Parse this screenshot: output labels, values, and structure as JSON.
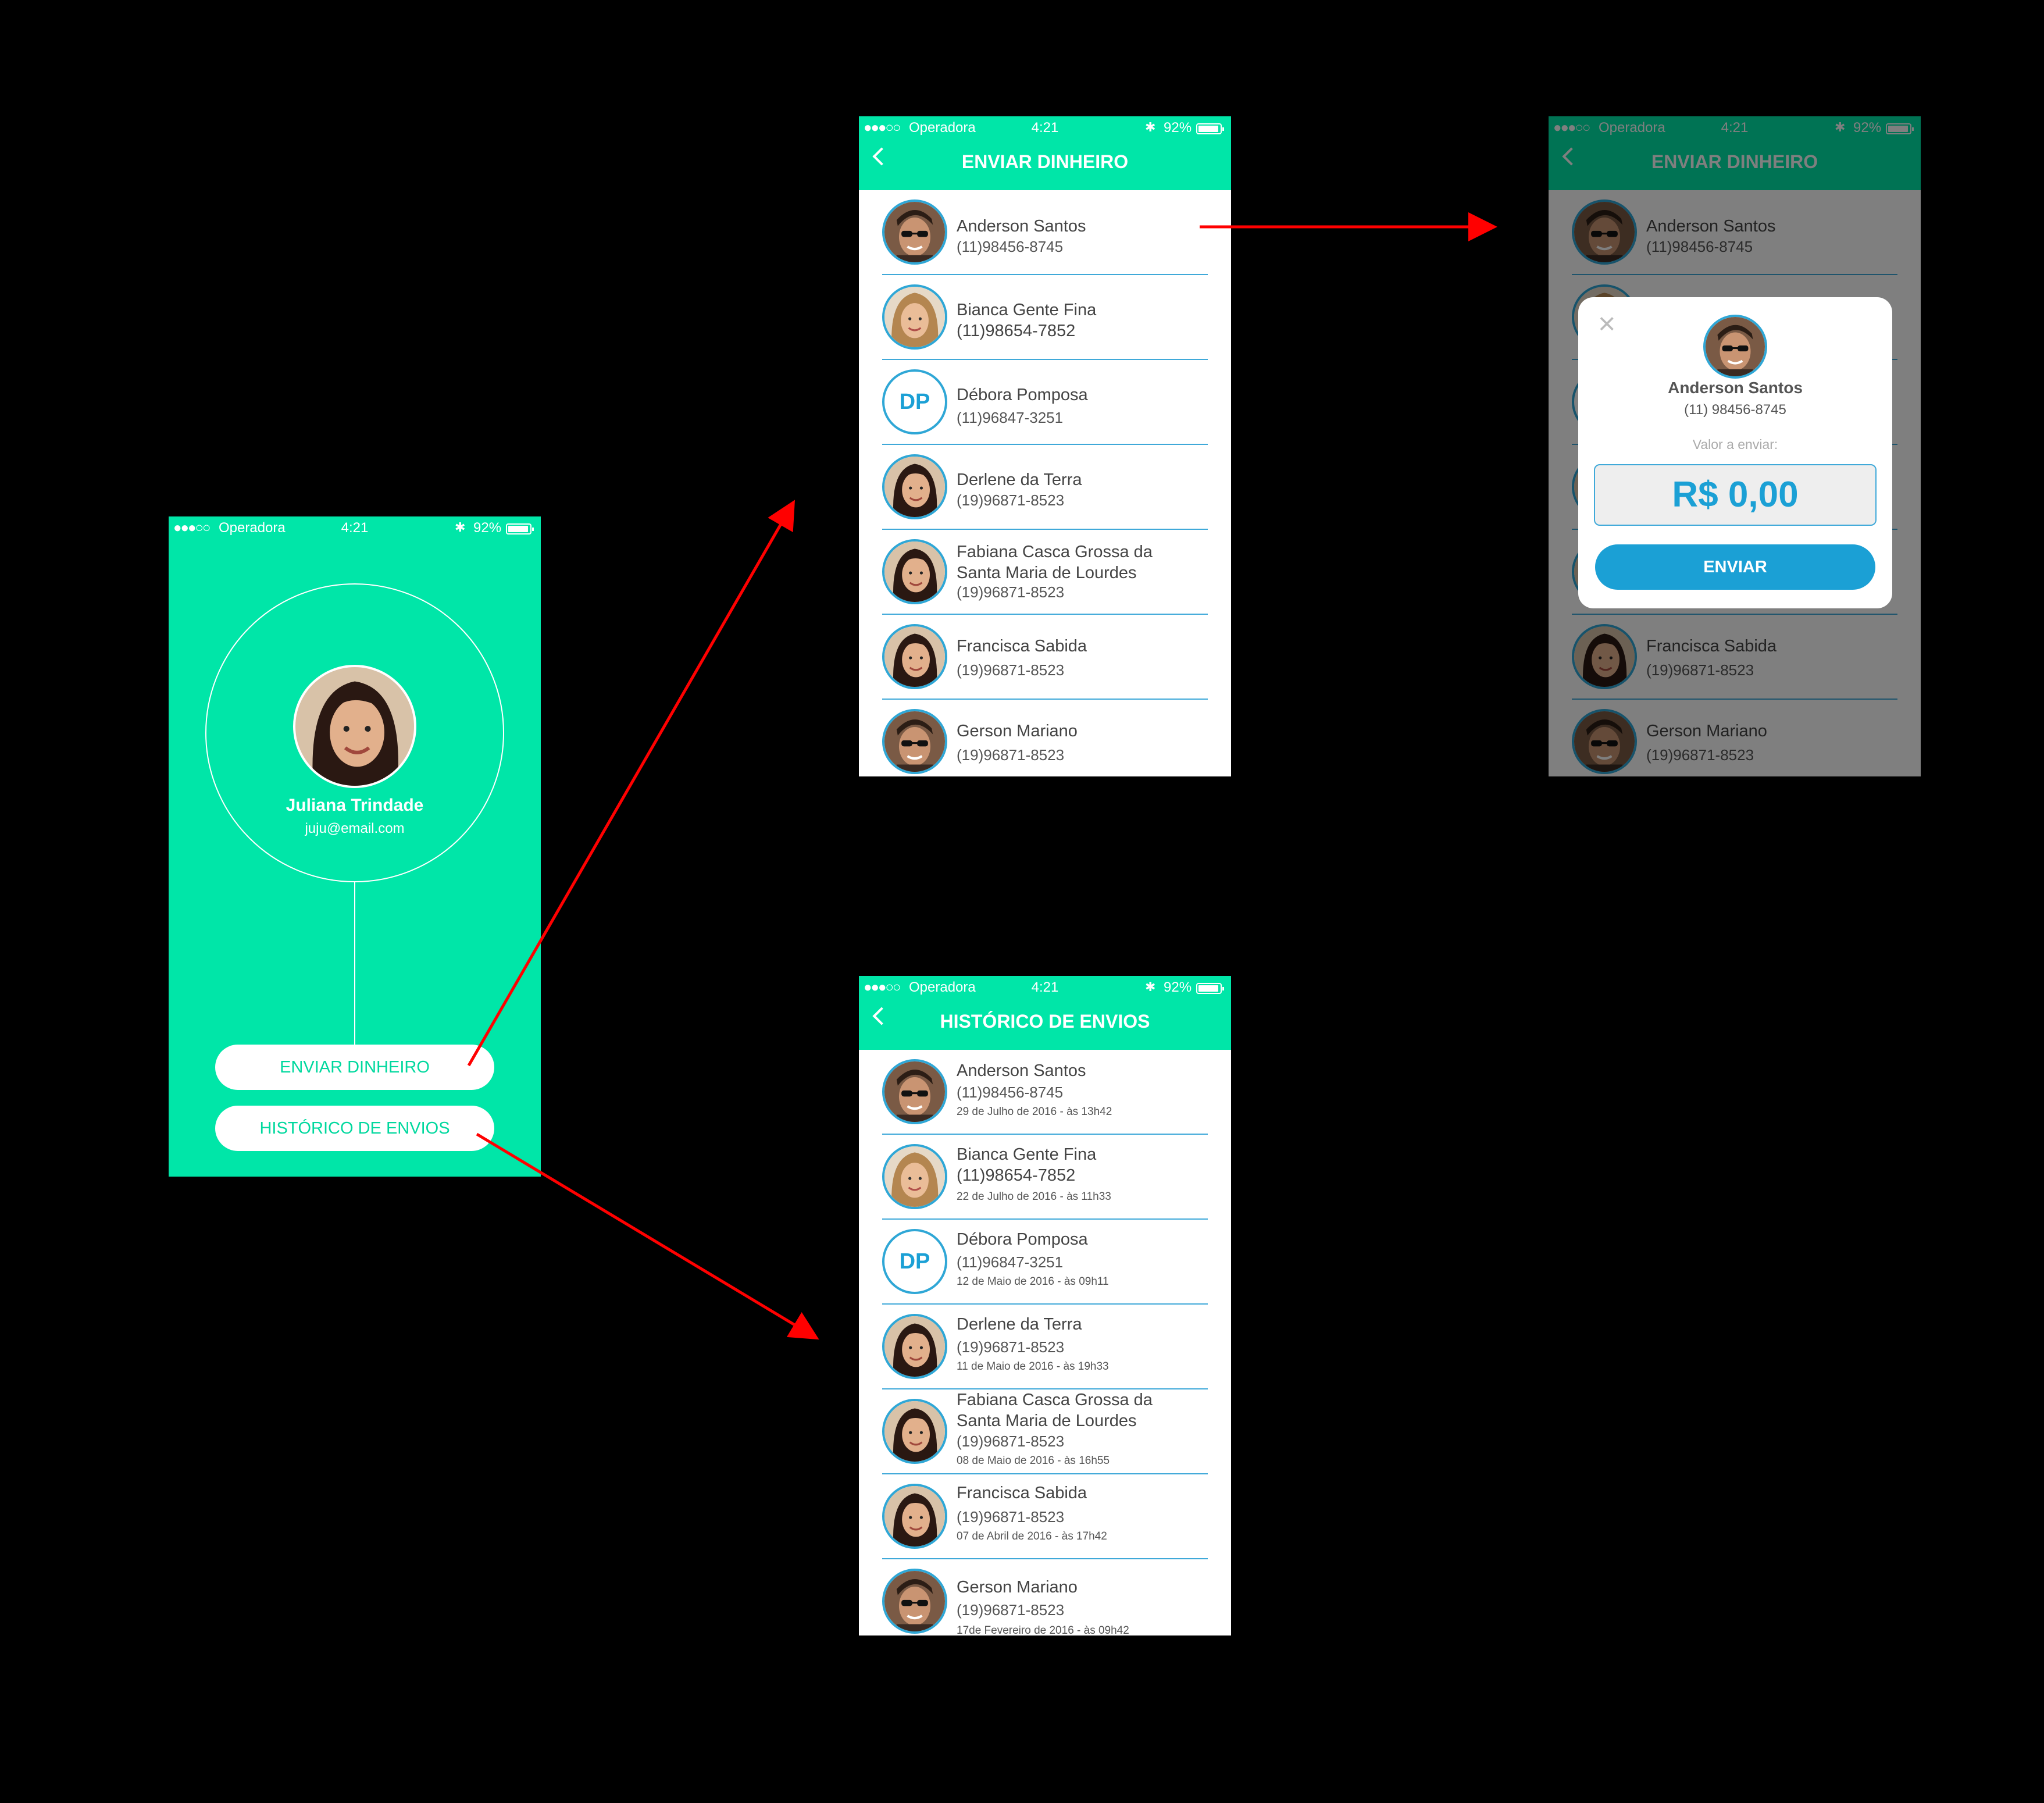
{
  "status_bar": {
    "signal": "●●●○○",
    "carrier": "Operadora",
    "time": "4:21",
    "bluetooth": "✱",
    "battery": "92%"
  },
  "home": {
    "user_name": "Juliana Trindade",
    "user_email": "juju@email.com",
    "send_button": "ENVIAR DINHEIRO",
    "history_button": "HISTÓRICO DE ENVIOS"
  },
  "send_screen": {
    "title": "ENVIAR DINHEIRO",
    "contacts": [
      {
        "name": "Anderson Santos",
        "phone": "(11)98456-8745",
        "avatar": "male-glasses"
      },
      {
        "name": "Bianca Gente Fina",
        "phone": "(11)98654-7852",
        "avatar": "female-blonde"
      },
      {
        "name": "Débora Pomposa",
        "phone": "(11)96847-3251",
        "initials": "DP"
      },
      {
        "name": "Derlene da Terra",
        "phone": "(19)96871-8523",
        "avatar": "female-short"
      },
      {
        "name": "Fabiana Casca Grossa da Santa Maria de Lourdes",
        "phone": "(19)96871-8523",
        "avatar": "female-curly"
      },
      {
        "name": "Francisca Sabida",
        "phone": "(19)96871-8523",
        "avatar": "female-long"
      },
      {
        "name": "Gerson Mariano",
        "phone": "(19)96871-8523",
        "avatar": "male-sunglasses"
      }
    ]
  },
  "modal": {
    "close": "×",
    "name": "Anderson Santos",
    "phone": "(11) 98456-8745",
    "amount_label": "Valor a enviar:",
    "amount": "R$ 0,00",
    "submit": "ENVIAR"
  },
  "history_screen": {
    "title": "HISTÓRICO DE ENVIOS",
    "entries": [
      {
        "name": "Anderson Santos",
        "phone": "(11)98456-8745",
        "date": "29 de Julho de 2016 - às 13h42"
      },
      {
        "name": "Bianca Gente Fina",
        "phone": "(11)98654-7852",
        "date": "22 de Julho de 2016 - às 11h33"
      },
      {
        "name": "Débora Pomposa",
        "phone": "(11)96847-3251",
        "date": "12 de Maio de 2016 - às 09h11",
        "initials": "DP"
      },
      {
        "name": "Derlene da Terra",
        "phone": "(19)96871-8523",
        "date": "11 de Maio de 2016 - às 19h33"
      },
      {
        "name": "Fabiana Casca Grossa da Santa Maria de Lourdes",
        "phone": "(19)96871-8523",
        "date": "08 de Maio de 2016 - às 16h55"
      },
      {
        "name": "Francisca Sabida",
        "phone": "(19)96871-8523",
        "date": "07 de Abril de 2016 - às 17h42"
      },
      {
        "name": "Gerson Mariano",
        "phone": "(19)96871-8523",
        "date": "17de Fevereiro de 2016 - às 09h42"
      }
    ]
  },
  "colors": {
    "primary": "#00E6A8",
    "accent_blue": "#1BA0D5",
    "arrow": "#FF0000"
  }
}
